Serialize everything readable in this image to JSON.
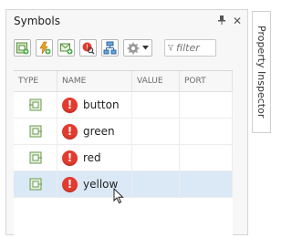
{
  "panel": {
    "title": "Symbols",
    "pin_glyph": "📌",
    "close_glyph": "✕"
  },
  "toolbar": {
    "buttons": [
      {
        "name": "add-data-icon"
      },
      {
        "name": "add-event-icon"
      },
      {
        "name": "add-message-icon"
      },
      {
        "name": "resolve-undefined-icon"
      },
      {
        "name": "open-model-explorer-icon"
      }
    ],
    "filter_placeholder": "filter"
  },
  "table": {
    "headers": {
      "type": "TYPE",
      "name": "NAME",
      "value": "VALUE",
      "port": "PORT"
    },
    "rows": [
      {
        "name": "button",
        "selected": false
      },
      {
        "name": "green",
        "selected": false
      },
      {
        "name": "red",
        "selected": false
      },
      {
        "name": "yellow",
        "selected": true
      }
    ],
    "error_glyph": "!"
  },
  "side_tab": {
    "label": "Property Inspector"
  },
  "colors": {
    "error": "#e33b2f",
    "selection": "#dbe9f7"
  }
}
